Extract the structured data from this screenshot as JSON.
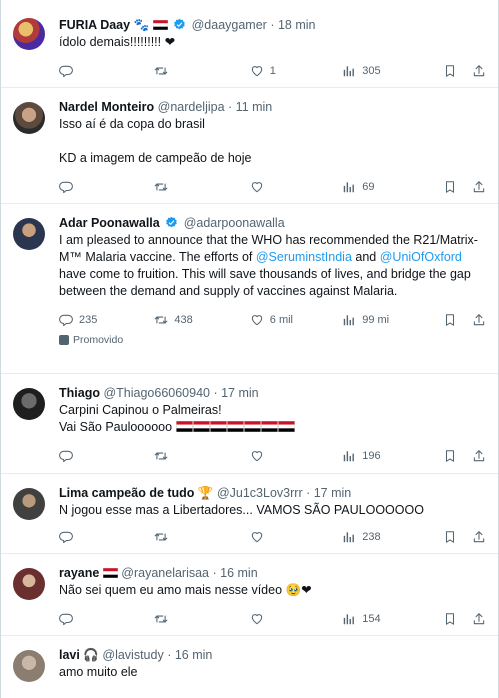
{
  "tweets": [
    {
      "name": "FURIA Daay",
      "name_extra": "🐾",
      "handle": "@daaygamer",
      "time": "· 18 min",
      "lines": [
        "ídolo demais!!!!!!!!! ❤"
      ],
      "reply": "",
      "retweet": "",
      "like": "1",
      "views": "305"
    },
    {
      "name": "Nardel Monteiro",
      "handle": "@nardeljipa",
      "time": "· 11 min",
      "lines": [
        "Isso aí é da copa do brasil",
        "",
        "KD a imagem de campeão de hoje"
      ],
      "reply": "",
      "retweet": "",
      "like": "",
      "views": "69"
    },
    {
      "name": "Adar Poonawalla",
      "handle": "@adarpoonawalla",
      "text_1": "I am pleased to announce that the WHO has recommended the R21/Matrix-M™ Malaria vaccine. The efforts of ",
      "mention_1": "@SeruminstIndia",
      "text_2": " and ",
      "mention_2": "@UniOfOxford",
      "text_3": " have come to fruition. This will save thousands of lives, and bridge the gap between the demand and supply of vaccines against Malaria.",
      "reply": "235",
      "retweet": "438",
      "like": "6 mil",
      "views": "99 mi",
      "promoted": "Promovido"
    },
    {
      "name": "Thiago",
      "handle": "@Thiago66060940",
      "time": "· 17 min",
      "lines": [
        "Carpini Capinou o Palmeiras!",
        "Vai São Pauloooooo"
      ],
      "reply": "",
      "retweet": "",
      "like": "",
      "views": "196"
    },
    {
      "name": "Lima campeão de tudo 🏆",
      "handle": "@Ju1c3Lov3rrr",
      "time": "· 17 min",
      "lines": [
        "N jogou esse mas a Libertadores... VAMOS SÃO PAULOOOOOO"
      ],
      "reply": "",
      "retweet": "",
      "like": "",
      "views": "238"
    },
    {
      "name": "rayane",
      "handle": "@rayanelarisaa",
      "time": "· 16 min",
      "lines": [
        "Não sei quem eu amo mais nesse vídeo 🥹❤"
      ],
      "reply": "",
      "retweet": "",
      "like": "",
      "views": "154"
    },
    {
      "name": "lavi 🎧",
      "handle": "@lavistudy",
      "time": "· 16 min",
      "lines": [
        "amo muito ele"
      ]
    }
  ],
  "colors": {
    "accent": "#1d9bf0",
    "muted": "#536471",
    "heart": "#f91880",
    "flag_red": "#ce1126",
    "flag_black": "#000000"
  }
}
